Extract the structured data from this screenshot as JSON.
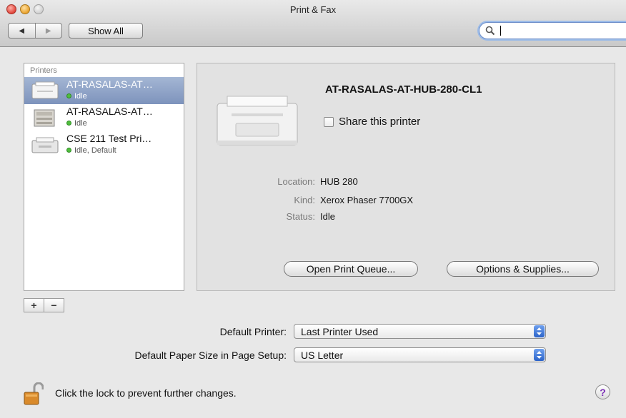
{
  "window": {
    "title": "Print & Fax"
  },
  "toolbar": {
    "back_glyph": "◀",
    "forward_glyph": "▶",
    "show_all_label": "Show All",
    "search_value": "",
    "search_icon": "magnifier-icon"
  },
  "printers": {
    "header": "Printers",
    "items": [
      {
        "name": "AT-RASALAS-AT…",
        "status": "Idle",
        "selected": true,
        "icon": "laser-printer-icon"
      },
      {
        "name": "AT-RASALAS-AT…",
        "status": "Idle",
        "selected": false,
        "icon": "multifunction-printer-icon"
      },
      {
        "name": "CSE 211 Test Pri…",
        "status": "Idle, Default",
        "selected": false,
        "icon": "desktop-printer-icon"
      }
    ],
    "add_glyph": "+",
    "remove_glyph": "−"
  },
  "detail": {
    "printer_name": "AT-RASALAS-AT-HUB-280-CL1",
    "share_label": "Share this printer",
    "share_checked": false,
    "location_label": "Location:",
    "location_value": "HUB 280",
    "kind_label": "Kind:",
    "kind_value": "Xerox Phaser 7700GX",
    "status_label": "Status:",
    "status_value": "Idle",
    "open_queue_label": "Open Print Queue...",
    "options_label": "Options & Supplies..."
  },
  "defaults": {
    "printer_label": "Default Printer:",
    "printer_value": "Last Printer Used",
    "paper_label": "Default Paper Size in Page Setup:",
    "paper_value": "US Letter"
  },
  "footer": {
    "lock_text": "Click the lock to prevent further changes.",
    "help_glyph": "?"
  },
  "colors": {
    "selection": "#7d93bc",
    "status_green": "#4fbe3d",
    "popup_blue": "#2b63c9"
  }
}
